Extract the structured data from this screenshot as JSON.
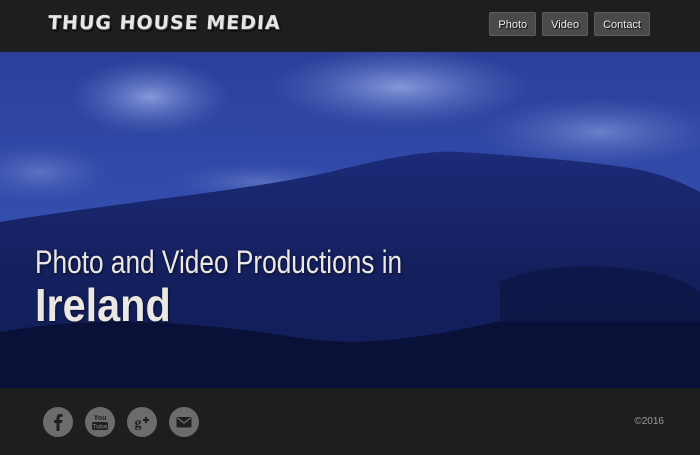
{
  "header": {
    "logo": "THUG HOUSE MEDIA",
    "nav": [
      "Photo",
      "Video",
      "Contact"
    ]
  },
  "hero": {
    "line1": "Photo and Video Productions in",
    "line2": "Ireland"
  },
  "footer": {
    "socials": [
      "facebook-icon",
      "youtube-icon",
      "google-plus-icon",
      "email-icon"
    ],
    "copyright": "©2016"
  },
  "colors": {
    "bar": "#1e1e1e",
    "hero_tint": "#1d2f8a",
    "nav_button": "#4a4a4a",
    "social_icon": "#6c6c6c"
  }
}
